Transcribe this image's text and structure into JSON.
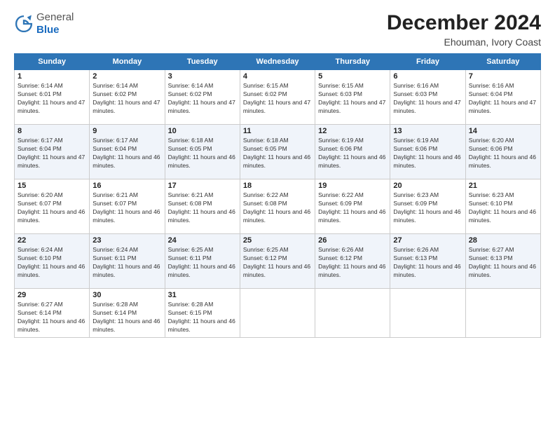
{
  "header": {
    "logo_general": "General",
    "logo_blue": "Blue",
    "month": "December 2024",
    "location": "Ehouman, Ivory Coast"
  },
  "days_of_week": [
    "Sunday",
    "Monday",
    "Tuesday",
    "Wednesday",
    "Thursday",
    "Friday",
    "Saturday"
  ],
  "weeks": [
    [
      {
        "day": "1",
        "sunrise": "6:14 AM",
        "sunset": "6:01 PM",
        "daylight": "11 hours and 47 minutes."
      },
      {
        "day": "2",
        "sunrise": "6:14 AM",
        "sunset": "6:02 PM",
        "daylight": "11 hours and 47 minutes."
      },
      {
        "day": "3",
        "sunrise": "6:14 AM",
        "sunset": "6:02 PM",
        "daylight": "11 hours and 47 minutes."
      },
      {
        "day": "4",
        "sunrise": "6:15 AM",
        "sunset": "6:02 PM",
        "daylight": "11 hours and 47 minutes."
      },
      {
        "day": "5",
        "sunrise": "6:15 AM",
        "sunset": "6:03 PM",
        "daylight": "11 hours and 47 minutes."
      },
      {
        "day": "6",
        "sunrise": "6:16 AM",
        "sunset": "6:03 PM",
        "daylight": "11 hours and 47 minutes."
      },
      {
        "day": "7",
        "sunrise": "6:16 AM",
        "sunset": "6:04 PM",
        "daylight": "11 hours and 47 minutes."
      }
    ],
    [
      {
        "day": "8",
        "sunrise": "6:17 AM",
        "sunset": "6:04 PM",
        "daylight": "11 hours and 47 minutes."
      },
      {
        "day": "9",
        "sunrise": "6:17 AM",
        "sunset": "6:04 PM",
        "daylight": "11 hours and 46 minutes."
      },
      {
        "day": "10",
        "sunrise": "6:18 AM",
        "sunset": "6:05 PM",
        "daylight": "11 hours and 46 minutes."
      },
      {
        "day": "11",
        "sunrise": "6:18 AM",
        "sunset": "6:05 PM",
        "daylight": "11 hours and 46 minutes."
      },
      {
        "day": "12",
        "sunrise": "6:19 AM",
        "sunset": "6:06 PM",
        "daylight": "11 hours and 46 minutes."
      },
      {
        "day": "13",
        "sunrise": "6:19 AM",
        "sunset": "6:06 PM",
        "daylight": "11 hours and 46 minutes."
      },
      {
        "day": "14",
        "sunrise": "6:20 AM",
        "sunset": "6:06 PM",
        "daylight": "11 hours and 46 minutes."
      }
    ],
    [
      {
        "day": "15",
        "sunrise": "6:20 AM",
        "sunset": "6:07 PM",
        "daylight": "11 hours and 46 minutes."
      },
      {
        "day": "16",
        "sunrise": "6:21 AM",
        "sunset": "6:07 PM",
        "daylight": "11 hours and 46 minutes."
      },
      {
        "day": "17",
        "sunrise": "6:21 AM",
        "sunset": "6:08 PM",
        "daylight": "11 hours and 46 minutes."
      },
      {
        "day": "18",
        "sunrise": "6:22 AM",
        "sunset": "6:08 PM",
        "daylight": "11 hours and 46 minutes."
      },
      {
        "day": "19",
        "sunrise": "6:22 AM",
        "sunset": "6:09 PM",
        "daylight": "11 hours and 46 minutes."
      },
      {
        "day": "20",
        "sunrise": "6:23 AM",
        "sunset": "6:09 PM",
        "daylight": "11 hours and 46 minutes."
      },
      {
        "day": "21",
        "sunrise": "6:23 AM",
        "sunset": "6:10 PM",
        "daylight": "11 hours and 46 minutes."
      }
    ],
    [
      {
        "day": "22",
        "sunrise": "6:24 AM",
        "sunset": "6:10 PM",
        "daylight": "11 hours and 46 minutes."
      },
      {
        "day": "23",
        "sunrise": "6:24 AM",
        "sunset": "6:11 PM",
        "daylight": "11 hours and 46 minutes."
      },
      {
        "day": "24",
        "sunrise": "6:25 AM",
        "sunset": "6:11 PM",
        "daylight": "11 hours and 46 minutes."
      },
      {
        "day": "25",
        "sunrise": "6:25 AM",
        "sunset": "6:12 PM",
        "daylight": "11 hours and 46 minutes."
      },
      {
        "day": "26",
        "sunrise": "6:26 AM",
        "sunset": "6:12 PM",
        "daylight": "11 hours and 46 minutes."
      },
      {
        "day": "27",
        "sunrise": "6:26 AM",
        "sunset": "6:13 PM",
        "daylight": "11 hours and 46 minutes."
      },
      {
        "day": "28",
        "sunrise": "6:27 AM",
        "sunset": "6:13 PM",
        "daylight": "11 hours and 46 minutes."
      }
    ],
    [
      {
        "day": "29",
        "sunrise": "6:27 AM",
        "sunset": "6:14 PM",
        "daylight": "11 hours and 46 minutes."
      },
      {
        "day": "30",
        "sunrise": "6:28 AM",
        "sunset": "6:14 PM",
        "daylight": "11 hours and 46 minutes."
      },
      {
        "day": "31",
        "sunrise": "6:28 AM",
        "sunset": "6:15 PM",
        "daylight": "11 hours and 46 minutes."
      },
      null,
      null,
      null,
      null
    ]
  ]
}
